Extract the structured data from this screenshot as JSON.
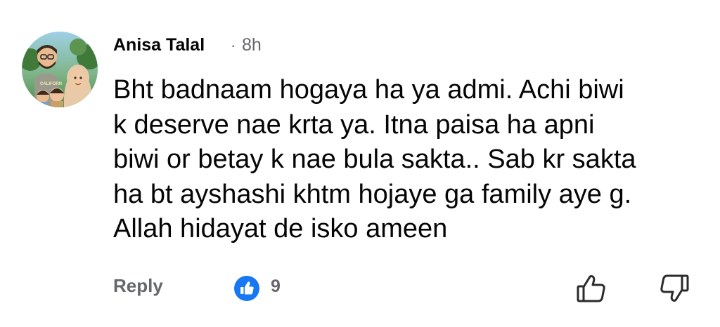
{
  "comment": {
    "author": "Anisa Talal",
    "separator": "·",
    "time": "8h",
    "text_lines": [
      "Bht badnaam hogaya ha ya admi. Achi biwi",
      "k deserve nae krta ya. Itna paisa ha apni",
      "biwi or betay k nae bula sakta.. Sab kr sakta",
      "ha bt ayshashi khtm hojaye ga family aye g.",
      "Allah hidayat de isko ameen"
    ],
    "avatar_shirt_text": "CALIFORN",
    "actions": {
      "reply_label": "Reply",
      "like_count": "9"
    }
  },
  "colors": {
    "text": "#050505",
    "secondary": "#65676b",
    "like_blue": "#1877f2"
  },
  "icons": {
    "avatar": "family-cartoon-avatar",
    "like_badge": "thumbs-up-badge-icon",
    "upvote": "thumbs-up-outline-icon",
    "downvote": "thumbs-down-outline-icon"
  }
}
